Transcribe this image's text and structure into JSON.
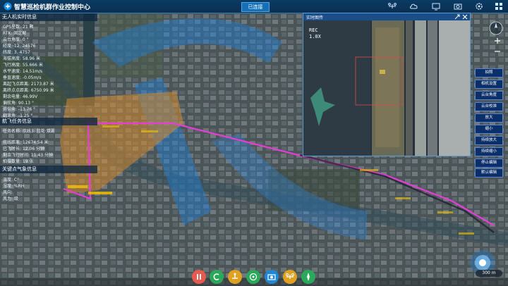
{
  "header": {
    "title": "智慧巡检机群作业控制中心",
    "connection_status": "已连接",
    "icons": [
      "drone-icon",
      "cloud-icon",
      "monitor-icon",
      "camera-icon",
      "settings-icon",
      "menu-icon"
    ]
  },
  "drone_info": {
    "title": "无人机实时信息",
    "rows": [
      "GPS星数: 21 颗",
      "RTK: 固定解",
      "云台角度: 0 °",
      "经度: 12.     24576",
      "纬度: 3.      4757",
      "海拔高度: 58.96 米",
      "飞行高度: 55.666 米",
      "水平速度: 14.51m/s",
      "垂直速度: -0.05m/s",
      "离起飞点距离: 2173.87 米",
      "离终点点距离: 6750.99 米",
      "剩余电量: 46.99V",
      "偏航角: 90.13 °",
      "俯仰角: -13.76 °",
      "翻滚角: -1.25 °"
    ]
  },
  "mission_info": {
    "title": "航飞任务信息",
    "rows": [
      "任务名称: 航线3: 蓝花·双湖",
      "航线距离: 12674.54 米",
      "已飞时长: 12.06 分钟",
      "剩余飞行时间: 11.43 分钟",
      "拍摄数量: 19 张"
    ]
  },
  "weather_info": {
    "title": "关键点气象信息",
    "rows": [
      "温度: C°",
      "湿度: %RH",
      "风向: ",
      "风力: 级"
    ]
  },
  "video": {
    "title": "实时图传",
    "rec_text": "REC",
    "zoom_text": "1.0X"
  },
  "controls": [
    "拍照",
    "相机设置",
    "云台角度",
    "云台校准",
    "放大",
    "缩小",
    "持续放大",
    "持续缩小",
    "停止编辑",
    "默认编辑"
  ],
  "bottom_buttons": [
    {
      "name": "pause-button",
      "icon": "pause-icon",
      "color": "#e85a4f"
    },
    {
      "name": "return-button",
      "icon": "return-icon",
      "color": "#2aa95a"
    },
    {
      "name": "takeoff-button",
      "icon": "takeoff-icon",
      "color": "#e0a020"
    },
    {
      "name": "target-button",
      "icon": "target-icon",
      "color": "#2aa95a"
    },
    {
      "name": "camera-button",
      "icon": "camera-icon",
      "color": "#1e88d8"
    },
    {
      "name": "drone-button",
      "icon": "drone-icon",
      "color": "#e0a020"
    },
    {
      "name": "compass-button",
      "icon": "compass-icon",
      "color": "#2aa95a"
    }
  ],
  "scale_label": "300 m",
  "colors": {
    "accent": "#1570b8",
    "route": "#e63dd6",
    "header": "#0b3b63"
  }
}
